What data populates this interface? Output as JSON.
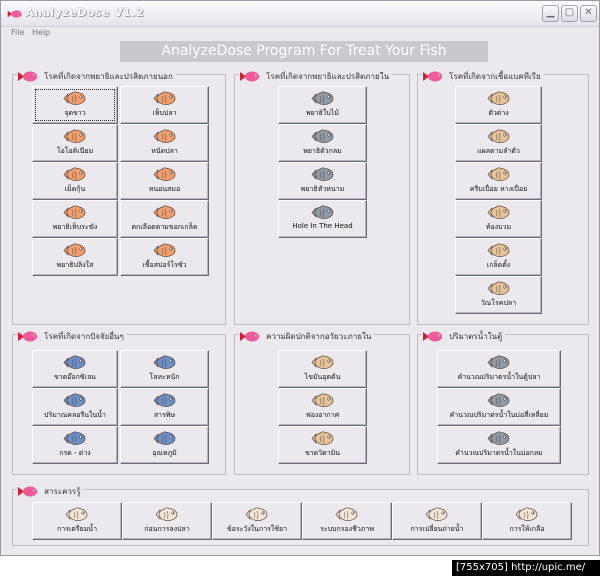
{
  "window": {
    "title": "AnalyzeDose V1.2"
  },
  "menu": {
    "items": [
      "File",
      "Help"
    ]
  },
  "banner": "AnalyzeDose Program  For Treat Your Fish",
  "groups": [
    {
      "title": "โรคที่เกิดจากพยาธิและปรสิตภายนอก",
      "buttons": [
        "จุดขาว",
        "เห็บปลา",
        "โอโอดิเนียม",
        "หนัดปลา",
        "เม็ดกุ้น",
        "หนอนสมอ",
        "พยาธิเห็บระฆัง",
        "ตกเลือดตามขอกเกล็ด",
        "พยาธิปลิงใส",
        "เชื้อสปอร์โรซัว"
      ]
    },
    {
      "title": "โรคที่เกิดจากพยาธิและปรสิตภายใน",
      "buttons": [
        "พยาธิใบไม้",
        "พยาธิตัวกลม",
        "พยาธิหัวหนาม",
        "Hole In The Head"
      ]
    },
    {
      "title": "โรคที่เกิดจากเชื้อแบคทีเรีย",
      "buttons": [
        "ตัวด่าง",
        "แผลตามลำตัว",
        "ครีบเปื่อย หางเปื่อย",
        "ท้องบวม",
        "เกล็ดตั้ง",
        "วัณโรคปลา"
      ]
    },
    {
      "title": "โรคที่เกิดจากปัจจัยอื่นๆ",
      "buttons": [
        "ขาดอ๊อกซิเจน",
        "โลหะหนัก",
        "ปริมาณคลอรีนในน้ำ",
        "สารพิษ",
        "กรด - ด่าง",
        "อุณหภูมิ"
      ]
    },
    {
      "title": "ความผิดปกติจากอวัยวะภายใน",
      "buttons": [
        "ไขมันอุดตัน",
        "ฟองอากาศ",
        "ขาดวิตามิน"
      ]
    },
    {
      "title": "ปริมาตรน้ำในตู้",
      "buttons": [
        "คำนวณปริมาตรน้ำในตู้ปลา",
        "คำนวณปริมาตรน้ำในบ่อสี่เหลี่ยม",
        "คำนวณปริมาตรน้ำในบ่อกลม"
      ]
    },
    {
      "title": "สาระควรรู้",
      "buttons": [
        "การเตรียมน้ำ",
        "ก่อนการลงปลา",
        "ข้อระวังในการใช้ยา",
        "ระบบกรองชีวภาพ",
        "การเปลี่ยนถ่ายน้ำ",
        "การให้เกลือ"
      ]
    }
  ],
  "statusbar": "[755x705] http://upic.me/",
  "colors": {
    "orange_fish": "#f0a070",
    "blue_fish": "#6c8fc8",
    "gray_fish": "#8f9aa8",
    "tan_fish": "#e6c49a",
    "pink_fish": "#e4303c"
  }
}
